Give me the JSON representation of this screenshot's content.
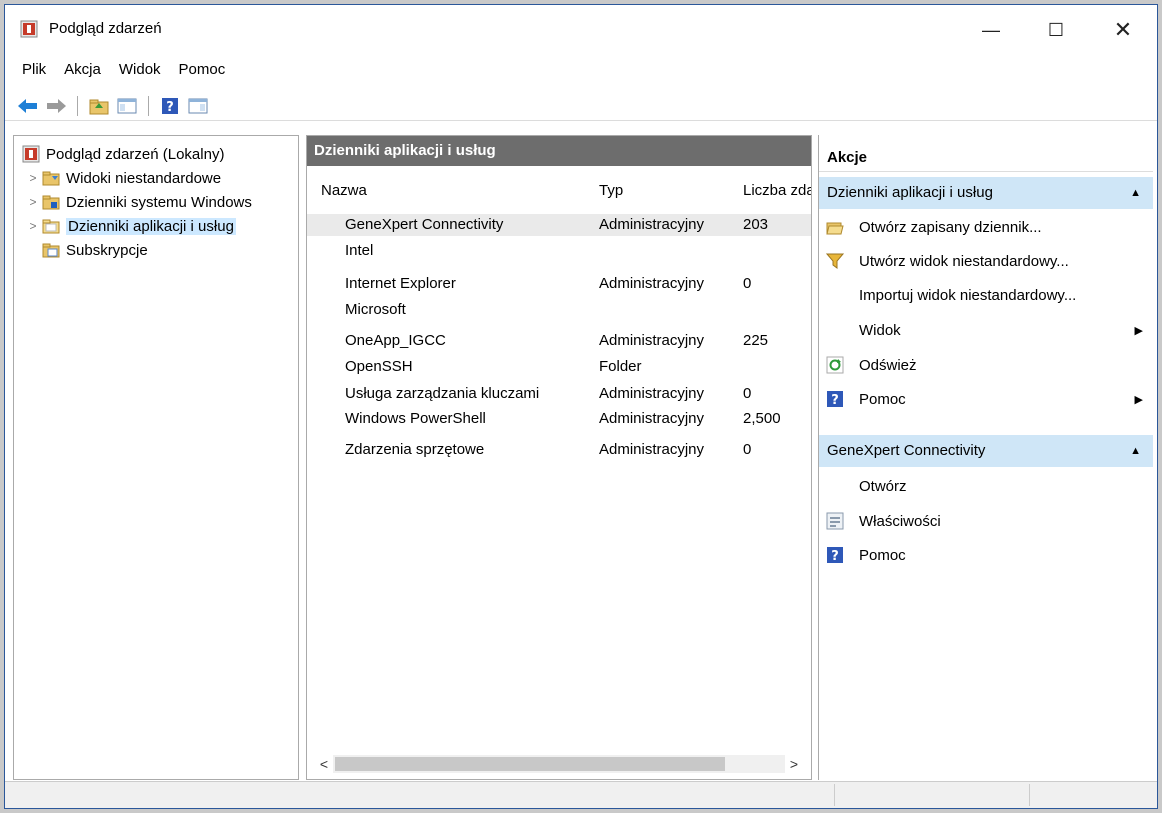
{
  "window": {
    "title": "Podgląd zdarzeń",
    "controls": {
      "minimize": "—",
      "maximize": "☐",
      "close": "✕"
    }
  },
  "menubar": [
    "Plik",
    "Akcja",
    "Widok",
    "Pomoc"
  ],
  "toolbar": {
    "buttons": [
      "back-icon",
      "forward-icon",
      "up-folder-icon",
      "show-hide-tree-icon",
      "help-icon",
      "show-hide-action-pane-icon"
    ]
  },
  "tree": {
    "root": "Podgląd zdarzeń (Lokalny)",
    "items": [
      {
        "label": "Widoki niestandardowe",
        "expandable": true
      },
      {
        "label": "Dzienniki systemu Windows",
        "expandable": true
      },
      {
        "label": "Dzienniki aplikacji i usług",
        "expandable": true,
        "selected": true
      },
      {
        "label": "Subskrypcje",
        "expandable": false
      }
    ]
  },
  "main": {
    "header": "Dzienniki aplikacji i usług",
    "columns": [
      "Nazwa",
      "Typ",
      "Liczba zdarzeń"
    ],
    "rows": [
      {
        "name": "GeneXpert Connectivity",
        "type": "Administracyjny",
        "count": "203"
      },
      {
        "name": "Intel",
        "type": "",
        "count": ""
      },
      {
        "name": "Internet Explorer",
        "type": "Administracyjny",
        "count": "0"
      },
      {
        "name": "Microsoft",
        "type": "",
        "count": ""
      },
      {
        "name": "OneApp_IGCC",
        "type": "Administracyjny",
        "count": "225"
      },
      {
        "name": "OpenSSH",
        "type": "Folder",
        "count": ""
      },
      {
        "name": "Usługa zarządzania kluczami",
        "type": "Administracyjny",
        "count": "0"
      },
      {
        "name": "Windows PowerShell",
        "type": "Administracyjny",
        "count": "2,500"
      },
      {
        "name": "Zdarzenia sprzętowe",
        "type": "Administracyjny",
        "count": "0"
      }
    ],
    "scroll": {
      "left": "<",
      "right": ">"
    }
  },
  "actions": {
    "title": "Akcje",
    "section1": {
      "label": "Dzienniki aplikacji i usług",
      "items": [
        {
          "label": "Otwórz zapisany dziennik...",
          "icon": "open-folder-icon"
        },
        {
          "label": "Utwórz widok niestandardowy...",
          "icon": "filter-icon"
        },
        {
          "label": "Importuj widok niestandardowy...",
          "icon": ""
        },
        {
          "label": "Widok",
          "icon": "",
          "submenu": true
        },
        {
          "label": "Odśwież",
          "icon": "refresh-icon"
        },
        {
          "label": "Pomoc",
          "icon": "help-icon",
          "submenu": true
        }
      ]
    },
    "section2": {
      "label": "GeneXpert Connectivity",
      "items": [
        {
          "label": "Otwórz",
          "icon": ""
        },
        {
          "label": "Właściwości",
          "icon": "properties-icon"
        },
        {
          "label": "Pomoc",
          "icon": "help-icon"
        }
      ]
    }
  },
  "colors": {
    "accent_selected": "#cce8ff",
    "mid_header_bg": "#6d6d6d",
    "action_section_bg": "#cfe6f7"
  }
}
